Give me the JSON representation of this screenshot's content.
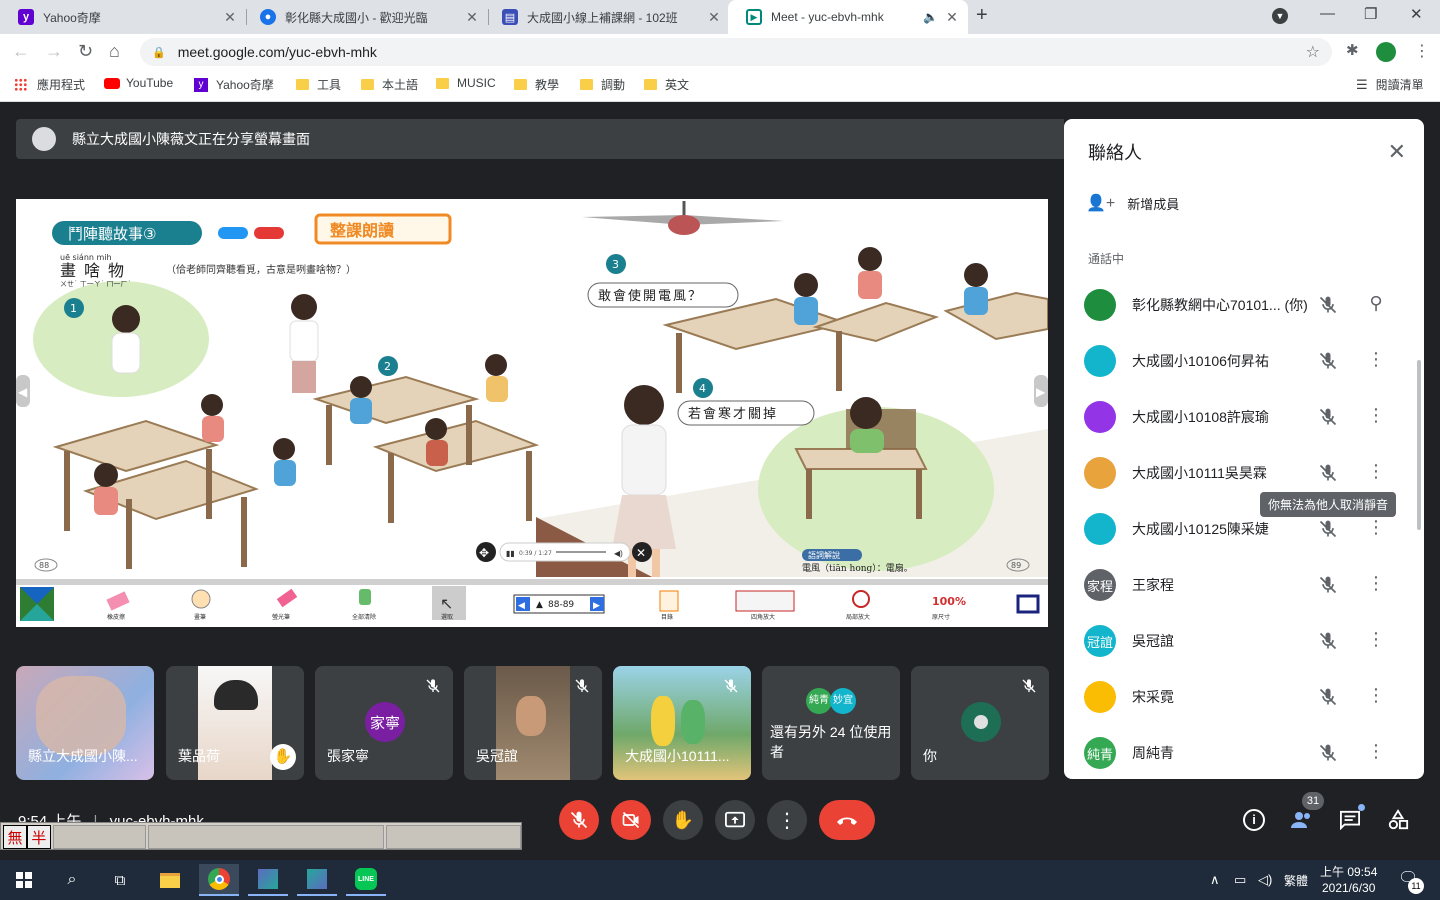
{
  "tabs": [
    {
      "title": "Yahoo奇摩",
      "favicon": "yahoo-icon"
    },
    {
      "title": "彰化縣大成國小 - 歡迎光臨",
      "favicon": "globe-icon"
    },
    {
      "title": "大成國小線上補課網 - 102班",
      "favicon": "sites-icon"
    },
    {
      "title": "Meet - yuc-ebvh-mhk",
      "favicon": "meet-icon"
    }
  ],
  "address": "meet.google.com/yuc-ebvh-mhk",
  "bookmarks": [
    "應用程式",
    "YouTube",
    "Yahoo奇摩",
    "工具",
    "本土語",
    "MUSIC",
    "教學",
    "調動",
    "英文"
  ],
  "reading_list": "閱讀清單",
  "share_banner": "縣立大成國小陳薇文正在分享螢幕畫面",
  "slide": {
    "title_tag": "鬥陣聽故事③",
    "read_button": "整課朗讀",
    "word": "畫啥物",
    "pinyin": "uē siánn mih",
    "zhuyin": "ㄨㄝ˙ ㄒ一ㄚ˙ ㄇ一ㄏ˙",
    "question": "（佮老師同齊聽看覓，古意是咧畫啥物？）",
    "num1": "1",
    "num2": "2",
    "num3": "3",
    "num4": "4",
    "bubble1": "敢會使開電風？",
    "bubble2": "若會寒才關掉",
    "vocab_tag": "語詞解說",
    "vocab": "電風（tiān hong）：電扇。",
    "page_left": "88",
    "page_right": "89",
    "player_time": "0:39 / 1:27",
    "page_range": "88-89",
    "tools": [
      "橡皮擦",
      "畫筆",
      "螢光筆",
      "全部清除",
      "選取",
      "目錄",
      "四角放大",
      "局部放大",
      "原尺寸"
    ],
    "zoom_label": "100%"
  },
  "tiles": [
    {
      "name": "縣立大成國小陳..."
    },
    {
      "name": "葉品荷"
    },
    {
      "name": "張家寧",
      "initials": "家寧"
    },
    {
      "name": "吳冠誼"
    },
    {
      "name": "大成國小10111..."
    },
    {
      "name": "還有另外 24 位使用者",
      "badges": [
        "純青",
        "妙宜"
      ]
    },
    {
      "name": "你"
    }
  ],
  "panel": {
    "title": "聯絡人",
    "add_people": "新增成員",
    "section": "通話中",
    "tooltip": "你無法為他人取消靜音",
    "people": [
      {
        "name": "彰化縣教網中心70101... (你)",
        "avatar": "",
        "color": "#1e8e3e"
      },
      {
        "name": "大成國小10106何昇祐",
        "avatar": "",
        "color": "#12b5cb"
      },
      {
        "name": "大成國小10108許宸瑜",
        "avatar": "",
        "color": "#9334e6"
      },
      {
        "name": "大成國小10111吳昊霖",
        "avatar": "",
        "color": "#e8a33d"
      },
      {
        "name": "大成國小10125陳采婕",
        "avatar": "",
        "color": "#12b5cb"
      },
      {
        "name": "王家程",
        "avatar": "家程",
        "color": "#5f6368"
      },
      {
        "name": "吳冠誼",
        "avatar": "冠誼",
        "color": "#12b5cb"
      },
      {
        "name": "宋采霓",
        "avatar": "",
        "color": "#fbbc04"
      },
      {
        "name": "周純青",
        "avatar": "純青",
        "color": "#34a853"
      }
    ]
  },
  "meeting": {
    "time": "9:54 上午",
    "code": "yuc-ebvh-mhk",
    "participant_count": "31"
  },
  "ime": {
    "k1": "無",
    "k2": "半"
  },
  "tray": {
    "lang": "繁體",
    "time": "上午 09:54",
    "date": "2021/6/30",
    "notif": "11"
  }
}
